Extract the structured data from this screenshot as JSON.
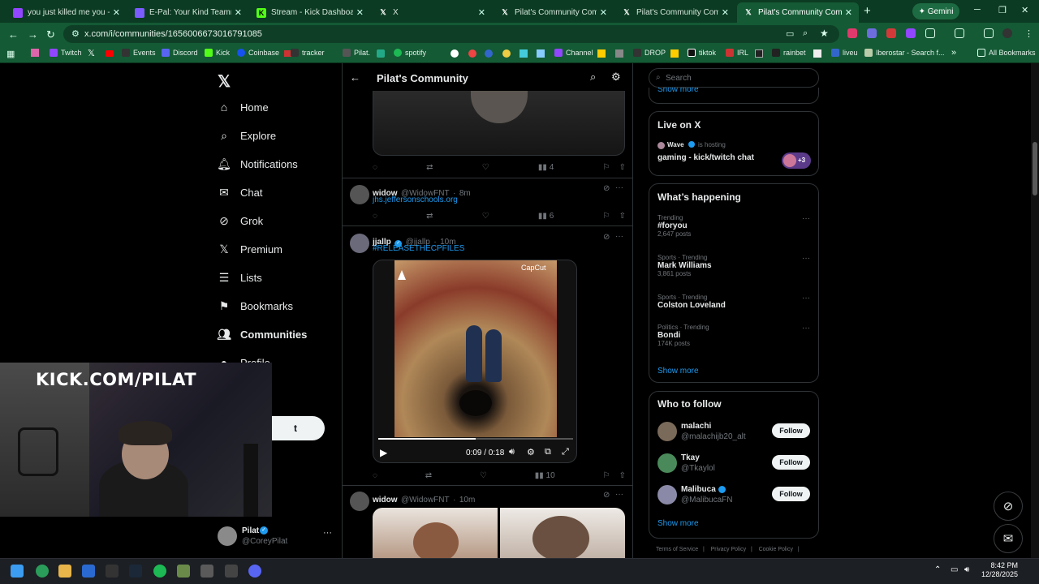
{
  "browser": {
    "tabs": [
      {
        "label": "you just killed me you - Twitc",
        "color": "#9146ff"
      },
      {
        "label": "E-Pal: Your Kind Teammates",
        "color": "#7b5cff"
      },
      {
        "label": "Stream - Kick Dashboard",
        "color": "#53fc18"
      },
      {
        "label": "X",
        "color": "#ffffff"
      },
      {
        "label": "Pilat's Community Communi",
        "color": "#ffffff"
      },
      {
        "label": "Pilat's Community Communi",
        "color": "#ffffff"
      },
      {
        "label": "Pilat's Community Communi",
        "color": "#ffffff"
      }
    ],
    "gemini_label": "Gemini",
    "url": "x.com/i/communities/1656006673016791085",
    "bookmarks": [
      "Twitch",
      "Events",
      "Discord",
      "Kick",
      "Coinbase",
      "tracker",
      "Pilat.",
      "spotify",
      "Channel",
      "DROP",
      "tiktok",
      "IRL",
      "rainbet",
      "liveu",
      "Iberostar - Search f..."
    ],
    "all_bookmarks_label": "All Bookmarks"
  },
  "sidebar": {
    "items": [
      {
        "label": "Home",
        "icon": "home-icon"
      },
      {
        "label": "Explore",
        "icon": "search-icon"
      },
      {
        "label": "Notifications",
        "icon": "bell-icon"
      },
      {
        "label": "Chat",
        "icon": "mail-icon"
      },
      {
        "label": "Grok",
        "icon": "grok-icon"
      },
      {
        "label": "Premium",
        "icon": "x-icon"
      },
      {
        "label": "Lists",
        "icon": "list-icon"
      },
      {
        "label": "Bookmarks",
        "icon": "bookmark-icon"
      },
      {
        "label": "Communities",
        "icon": "people-icon"
      },
      {
        "label": "Profile",
        "icon": "person-icon"
      }
    ],
    "post_button_label": "t",
    "profile": {
      "name": "Pilat",
      "handle": "@CoreyPilat"
    }
  },
  "header": {
    "title": "Pilat's Community"
  },
  "posts": [
    {
      "views": "4"
    },
    {
      "name": "widow",
      "handle": "@WidowFNT",
      "time": "8m",
      "link": "jhs.jeffersonschools.org",
      "views": "6"
    },
    {
      "name": "jjallp",
      "handle": "@jjallp",
      "time": "10m",
      "hashtag": "#RELEASETHECPFILES",
      "video_time": "0:09 / 0:18",
      "watermark": "CapCut",
      "views": "10"
    },
    {
      "name": "widow",
      "handle": "@WidowFNT",
      "time": "10m"
    }
  ],
  "right": {
    "search_placeholder": "Search",
    "show_more_top": "Show more",
    "live": {
      "title": "Live on X",
      "host": "Wave",
      "hosting": "is hosting",
      "stream_title": "gaming - kick/twitch chat",
      "extra": "+3"
    },
    "trending": {
      "title": "What’s happening",
      "items": [
        {
          "context": "Trending",
          "topic": "#foryou",
          "count": "2,647 posts"
        },
        {
          "context": "Sports · Trending",
          "topic": "Mark Williams",
          "count": "3,861 posts"
        },
        {
          "context": "Sports · Trending",
          "topic": "Colston Loveland",
          "count": ""
        },
        {
          "context": "Politics · Trending",
          "topic": "Bondi",
          "count": "174K posts"
        }
      ],
      "show_more": "Show more"
    },
    "follow": {
      "title": "Who to follow",
      "items": [
        {
          "name": "malachi",
          "handle": "@malachijb20_alt"
        },
        {
          "name": "Tkay",
          "handle": "@Tkaylol"
        },
        {
          "name": "Malibuca",
          "handle": "@MalibucaFN"
        }
      ],
      "button_label": "Follow",
      "show_more": "Show more"
    },
    "footer": [
      "Terms of Service",
      "Privacy Policy",
      "Cookie Policy"
    ]
  },
  "overlay": {
    "kick_text": "KICK.COM/PILAT"
  },
  "taskbar": {
    "time": "8:42 PM",
    "date": "12/28/2025"
  }
}
